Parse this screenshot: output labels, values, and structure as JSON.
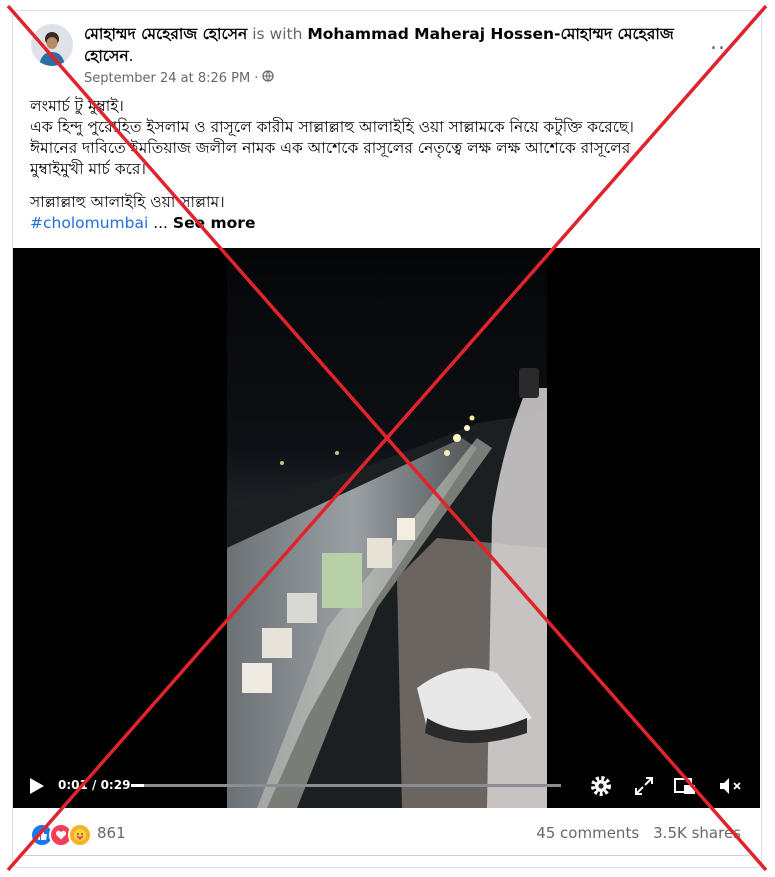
{
  "post": {
    "author": "মোহাম্মদ মেহেরাজ হোসেন",
    "with_text": "is with",
    "tagged": "Mohammad Maheraj Hossen-মোহাম্মদ মেহেরাজ হোসেন",
    "tagged_suffix": ".",
    "timestamp": "September 24 at 8:26 PM",
    "separator": "·",
    "audience_icon": "globe-icon",
    "more_icon": "more-options-icon",
    "more_label": "...",
    "lines": [
      "লংমার্চ টু মুম্বাই।",
      "এক হিন্দু পুরোহিত ইসলাম ও রাসূলে কারীম সাল্লাল্লাহু আলাইহি ওয়া সাল্লামকে নিয়ে কটুক্তি করেছে।",
      "ঈমানের দাবিতে ইমতিয়াজ জলীল নামক এক আশেকে রাসূলের নেতৃত্বে লক্ষ লক্ষ আশেকে রাসূলের",
      "মুম্বাইমুখী মার্চ করে।"
    ],
    "salutation": "সাল্লাল্লাহু আলাইহি ওয়া সাল্লাম।",
    "hashtag": "#cholomumbai",
    "ellipsis": " ... ",
    "see_more": "See more"
  },
  "video": {
    "time": "0:01 / 0:29",
    "progress": 0.03,
    "icons": [
      "play-icon",
      "settings-icon",
      "fullscreen-icon",
      "picture-in-picture-icon",
      "mute-icon"
    ]
  },
  "footer": {
    "reaction_icons": [
      "like-icon",
      "love-icon",
      "care-icon"
    ],
    "reaction_count": "861",
    "comments": "45 comments",
    "shares": "3.5K shares"
  },
  "colors": {
    "link": "#216fdb",
    "muted": "#65676b",
    "cross": "#e0242d"
  }
}
